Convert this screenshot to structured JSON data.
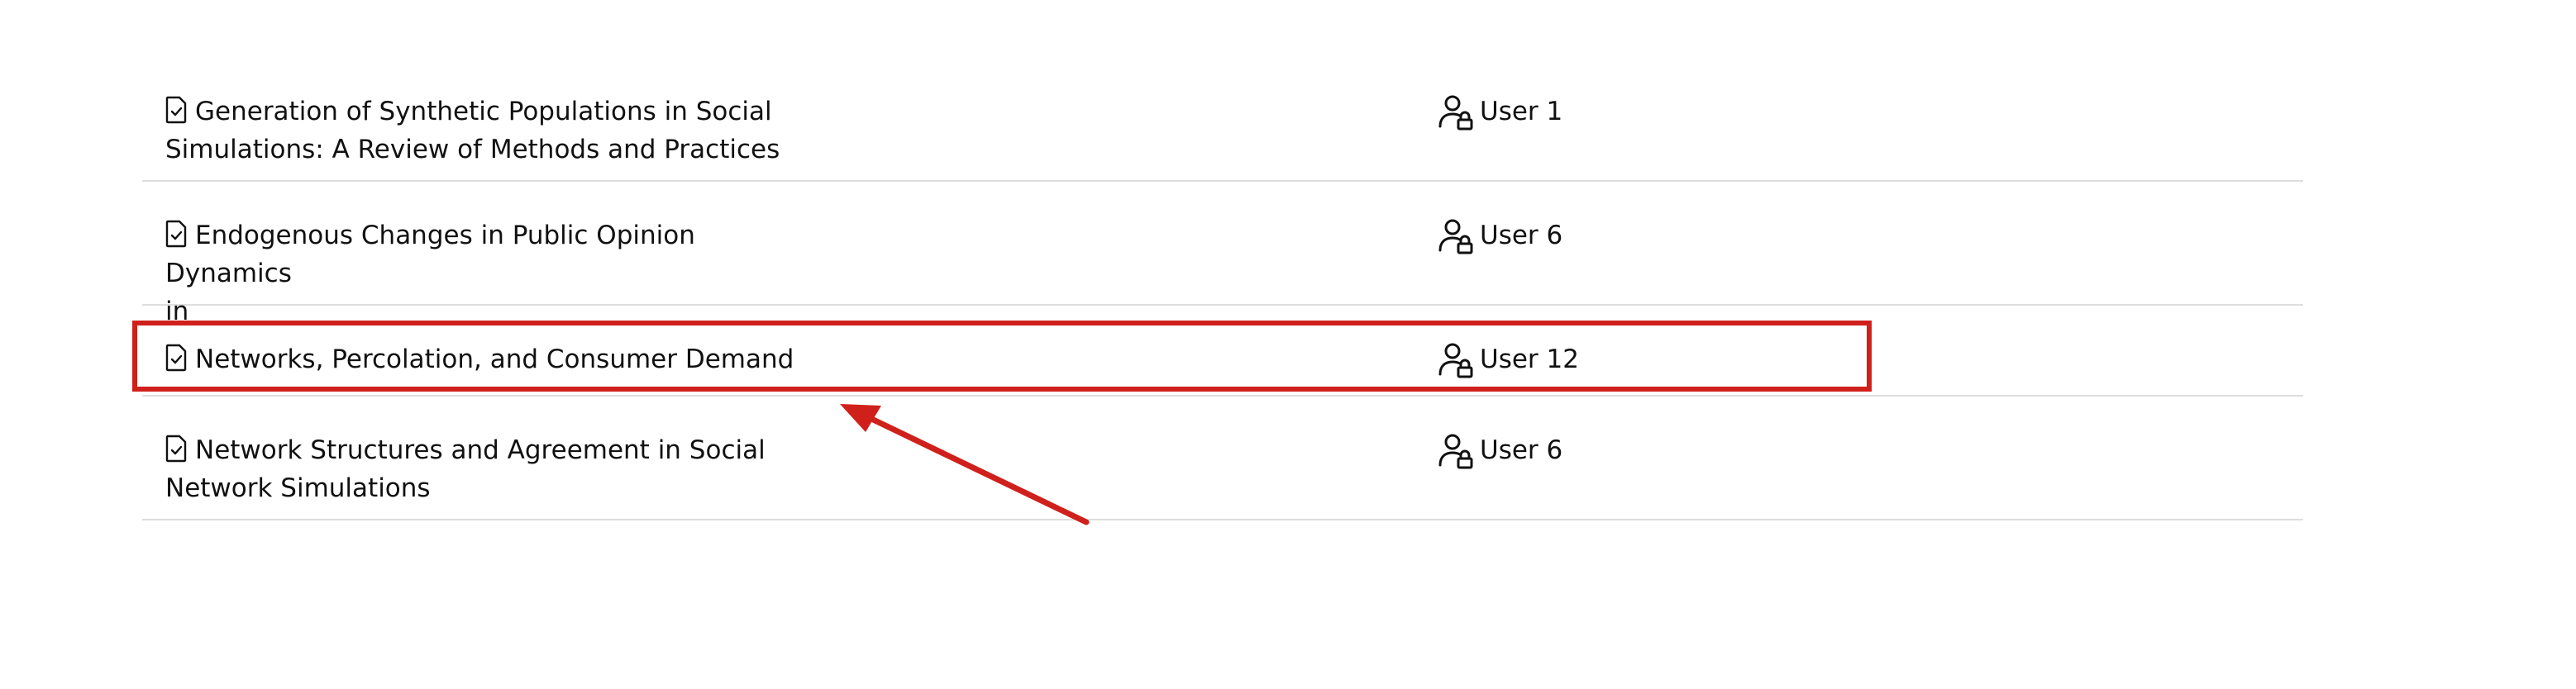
{
  "rows": [
    {
      "title_line1": "Generation of Synthetic Populations in Social",
      "title_line2": "Simulations: A Review of Methods and Practices",
      "owner": "User 1"
    },
    {
      "title_line1": "Endogenous Changes in Public Opinion Dynamics",
      "title_line2": "in",
      "owner": "User 6"
    },
    {
      "title_line1": "Networks, Percolation, and Consumer Demand",
      "title_line2": "",
      "owner": "User 12"
    },
    {
      "title_line1": "Network Structures and Agreement in Social",
      "title_line2": "Network Simulations",
      "owner": "User 6"
    }
  ],
  "icons": {
    "document": "document-check-icon",
    "user": "user-lock-icon"
  },
  "annotation": {
    "color": "#d0201b"
  }
}
